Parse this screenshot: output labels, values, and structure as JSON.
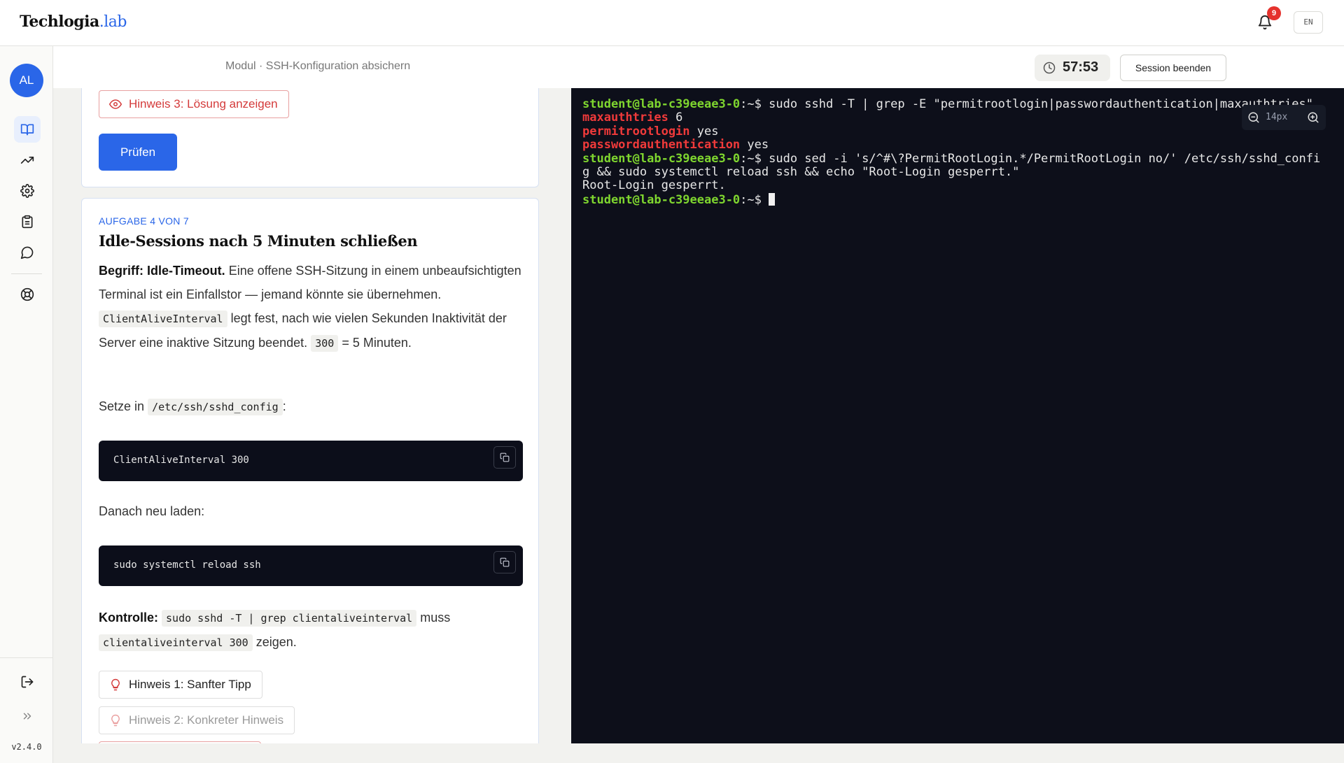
{
  "header": {
    "brand_main": "Techlogia",
    "brand_suffix": ".lab",
    "notifications_count": "9",
    "language": "EN"
  },
  "sidebar": {
    "avatar_initials": "AL",
    "version": "v2.4.0"
  },
  "subheader": {
    "breadcrumb": "Modul · SSH-Konfiguration absichern",
    "timer": "57:53",
    "end_session": "Session beenden"
  },
  "previous_task": {
    "hint3_label": "Hinweis 3: Lösung anzeigen",
    "check_label": "Prüfen"
  },
  "task": {
    "kicker": "AUFGABE 4 VON 7",
    "title": "Idle-Sessions nach 5 Minuten schließen",
    "intro_term": "Begriff: Idle-Timeout.",
    "intro_text_1": "Eine offene SSH-Sitzung in einem unbeaufsichtigten Terminal ist ein Einfallstor — jemand könnte sie übernehmen.",
    "intro_code": "ClientAliveInterval",
    "intro_text_2": "legt fest, nach wie vielen Sekunden Inaktivität der Server eine inaktive Sitzung beendet.",
    "intro_value": "300",
    "intro_text_3": "= 5 Minuten.",
    "set_in_prefix": "Setze in",
    "set_in_path": "/etc/ssh/sshd_config",
    "set_in_suffix": ":",
    "code1": "ClientAliveInterval 300",
    "reload_text": "Danach neu laden:",
    "code2": "sudo systemctl reload ssh",
    "control_label": "Kontrolle:",
    "control_cmd": "sudo sshd -T | grep clientaliveinterval",
    "control_mid": "muss",
    "control_expected": "clientaliveinterval 300",
    "control_end": "zeigen.",
    "hint1_label": "Hinweis 1: Sanfter Tipp",
    "hint2_label": "Hinweis 2: Konkreter Hinweis"
  },
  "terminal": {
    "prompt": "student@lab-c39eeae3-0",
    "prompt_suffix": ":~$ ",
    "cmd1": "sudo sshd -T | grep -E \"permitrootlogin|passwordauthentication|maxauthtries\"",
    "out1_key": "maxauthtries",
    "out1_val": " 6",
    "out2_key": "permitrootlogin",
    "out2_val": " yes",
    "out3_key": "passwordauthentication",
    "out3_val": " yes",
    "cmd2_line1": "sudo sed -i 's/^#\\?PermitRootLogin.*/PermitRootLogin no/' /etc/ssh/sshd_confi",
    "cmd2_line2": "g && sudo systemctl reload ssh && echo \"Root-Login gesperrt.\"",
    "out4": "Root-Login gesperrt.",
    "font_size": "14px"
  },
  "colors": {
    "accent": "#2a66e8",
    "terminal_bg": "#0d0f1a",
    "prompt_green": "#7fd62f",
    "match_red": "#f03a3a",
    "badge_red": "#e5322d"
  }
}
